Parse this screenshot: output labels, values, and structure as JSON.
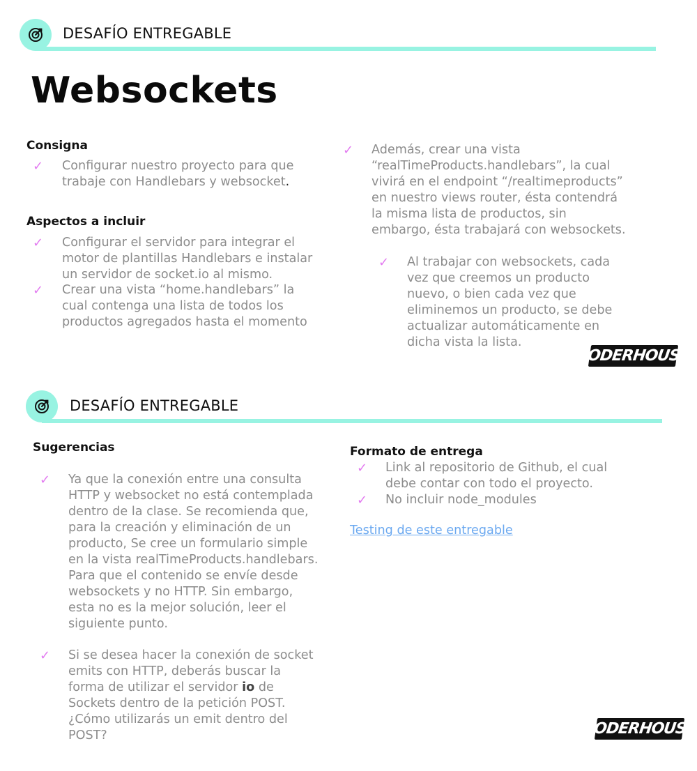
{
  "slide1": {
    "header": "DESAFÍO ENTREGABLE",
    "title": "Websockets",
    "consigna": {
      "label": "Consigna",
      "items": [
        "Configurar nuestro proyecto para que trabaje con Handlebars y websocket"
      ],
      "trailing": "."
    },
    "aspectos": {
      "label": "Aspectos a incluir",
      "items": [
        "Configurar el servidor para integrar el motor de plantillas Handlebars e instalar un servidor de socket.io al mismo.",
        "Crear una vista “home.handlebars” la cual contenga una lista de todos los productos agregados hasta el momento"
      ]
    },
    "right": {
      "item": "Además, crear una vista “realTimeProducts.handlebars”, la cual vivirá en el endpoint “/realtimeproducts” en nuestro views router, ésta contendrá la misma lista de productos, sin embargo, ésta trabajará con websockets.",
      "subitem": "Al trabajar con websockets, cada vez que creemos un producto nuevo, o bien cada vez que eliminemos un producto, se debe actualizar automáticamente en dicha vista la lista."
    },
    "logo": "CODERHOUSE"
  },
  "slide2": {
    "header": "DESAFÍO ENTREGABLE",
    "sugerencias": {
      "label": "Sugerencias",
      "item1": "Ya que la conexión entre una consulta HTTP y websocket no está contemplada dentro de la clase. Se recomienda que, para la creación y eliminación de un producto, Se cree un formulario simple en la vista realTimeProducts.handlebars. Para que el contenido se envíe desde websockets y no HTTP. Sin embargo, esta no es la mejor solución, leer el siguiente punto.",
      "item2_before": "Si se desea hacer la conexión de socket emits con HTTP, deberás buscar la forma de utilizar el servidor ",
      "item2_bold": "io",
      "item2_after": " de Sockets dentro de la petición POST. ¿Cómo utilizarás un emit dentro del POST?"
    },
    "formato": {
      "label": "Formato de entrega",
      "items": [
        "Link al repositorio de Github, el cual debe contar con todo el proyecto.",
        "No incluir node_modules"
      ]
    },
    "link": "Testing de este entregable",
    "logo": "CODERHOUSE"
  },
  "icons": {
    "badge": "target-icon",
    "bullet": "checkmark-icon"
  },
  "colors": {
    "accent": "#98f3e2",
    "check": "#e27af0",
    "muted_text": "#8c8c8c",
    "link": "#6aa8f0"
  }
}
